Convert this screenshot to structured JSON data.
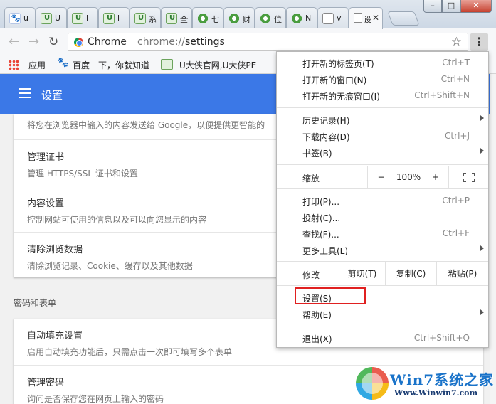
{
  "tabs": [
    {
      "icon": "baidu-paw-icon",
      "label": "u"
    },
    {
      "icon": "uxia-logo-icon",
      "label": "U"
    },
    {
      "icon": "uxia-logo-icon",
      "label": "l"
    },
    {
      "icon": "uxia-logo-icon",
      "label": "l"
    },
    {
      "icon": "uxia-logo-icon",
      "label": "系"
    },
    {
      "icon": "uxia-logo-icon",
      "label": "全"
    },
    {
      "icon": "green-site-icon",
      "label": "七"
    },
    {
      "icon": "green-site-icon",
      "label": "财"
    },
    {
      "icon": "green-site-icon",
      "label": "位"
    },
    {
      "icon": "green-site-icon",
      "label": "N"
    },
    {
      "icon": "page-icon",
      "label": "v"
    },
    {
      "icon": "settings-icon",
      "label": "设",
      "active": true
    }
  ],
  "toolbar": {
    "back": "←",
    "forward": "→",
    "reload": "↻",
    "omnibox_site": "Chrome",
    "omnibox_scheme": "chrome://",
    "omnibox_path": "settings",
    "star": "☆",
    "menu": "⋮"
  },
  "window_controls": {
    "minimize": "–",
    "maximize": "□",
    "close": "✕"
  },
  "bookmarks": {
    "apps": "应用",
    "baidu": "百度一下，你就知道",
    "uxia": "U大侠官网,U大侠PE"
  },
  "settings": {
    "title": "设置",
    "top_partial": "将您在浏览器中输入的内容发送给 Google，以便提供更智能的",
    "rows": [
      {
        "title": "管理证书",
        "sub": "管理 HTTPS/SSL 证书和设置"
      },
      {
        "title": "内容设置",
        "sub": "控制网站可使用的信息以及可以向您显示的内容"
      },
      {
        "title": "清除浏览数据",
        "sub": "清除浏览记录、Cookie、缓存以及其他数据"
      }
    ],
    "section": "密码和表单",
    "rows2": [
      {
        "title": "自动填充设置",
        "sub": "启用自动填充功能后，只需点击一次即可填写多个表单"
      },
      {
        "title": "管理密码",
        "sub": "询问是否保存您在网页上输入的密码"
      }
    ]
  },
  "menu": {
    "new_tab": {
      "label": "打开新的标签页(T)",
      "key": "Ctrl+T"
    },
    "new_window": {
      "label": "打开新的窗口(N)",
      "key": "Ctrl+N"
    },
    "incognito": {
      "label": "打开新的无痕窗口(I)",
      "key": "Ctrl+Shift+N"
    },
    "history": {
      "label": "历史记录(H)"
    },
    "downloads": {
      "label": "下载内容(D)",
      "key": "Ctrl+J"
    },
    "bookmarks": {
      "label": "书签(B)"
    },
    "zoom": {
      "label": "缩放",
      "minus": "−",
      "value": "100%",
      "plus": "+"
    },
    "print": {
      "label": "打印(P)...",
      "key": "Ctrl+P"
    },
    "cast": {
      "label": "投射(C)..."
    },
    "find": {
      "label": "查找(F)...",
      "key": "Ctrl+F"
    },
    "more_tools": {
      "label": "更多工具(L)"
    },
    "edit": {
      "label": "修改",
      "cut": "剪切(T)",
      "copy": "复制(C)",
      "paste": "粘贴(P)"
    },
    "settings": {
      "label": "设置(S)"
    },
    "help": {
      "label": "帮助(E)"
    },
    "exit": {
      "label": "退出(X)",
      "key": "Ctrl+Shift+Q"
    }
  },
  "watermark": {
    "brand": "Win7系统之家",
    "url": "Www.Winwin7.com"
  },
  "colors": {
    "appbar": "#3b78e7",
    "highlight": "#e02020"
  }
}
